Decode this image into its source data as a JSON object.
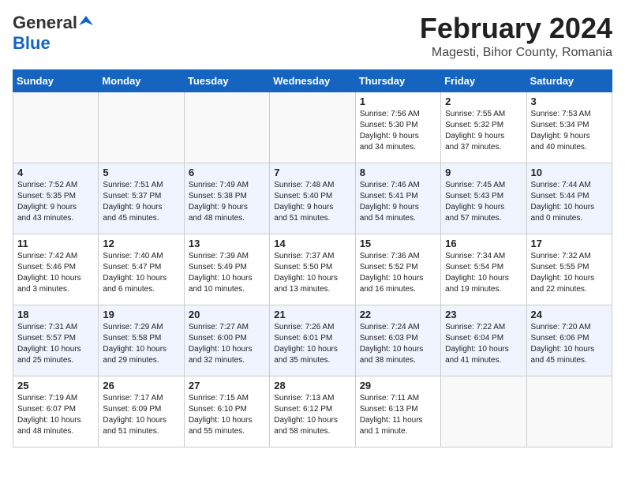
{
  "logo": {
    "general": "General",
    "blue": "Blue"
  },
  "title": "February 2024",
  "location": "Magesti, Bihor County, Romania",
  "days_of_week": [
    "Sunday",
    "Monday",
    "Tuesday",
    "Wednesday",
    "Thursday",
    "Friday",
    "Saturday"
  ],
  "weeks": [
    [
      {
        "day": "",
        "info": ""
      },
      {
        "day": "",
        "info": ""
      },
      {
        "day": "",
        "info": ""
      },
      {
        "day": "",
        "info": ""
      },
      {
        "day": "1",
        "info": "Sunrise: 7:56 AM\nSunset: 5:30 PM\nDaylight: 9 hours\nand 34 minutes."
      },
      {
        "day": "2",
        "info": "Sunrise: 7:55 AM\nSunset: 5:32 PM\nDaylight: 9 hours\nand 37 minutes."
      },
      {
        "day": "3",
        "info": "Sunrise: 7:53 AM\nSunset: 5:34 PM\nDaylight: 9 hours\nand 40 minutes."
      }
    ],
    [
      {
        "day": "4",
        "info": "Sunrise: 7:52 AM\nSunset: 5:35 PM\nDaylight: 9 hours\nand 43 minutes."
      },
      {
        "day": "5",
        "info": "Sunrise: 7:51 AM\nSunset: 5:37 PM\nDaylight: 9 hours\nand 45 minutes."
      },
      {
        "day": "6",
        "info": "Sunrise: 7:49 AM\nSunset: 5:38 PM\nDaylight: 9 hours\nand 48 minutes."
      },
      {
        "day": "7",
        "info": "Sunrise: 7:48 AM\nSunset: 5:40 PM\nDaylight: 9 hours\nand 51 minutes."
      },
      {
        "day": "8",
        "info": "Sunrise: 7:46 AM\nSunset: 5:41 PM\nDaylight: 9 hours\nand 54 minutes."
      },
      {
        "day": "9",
        "info": "Sunrise: 7:45 AM\nSunset: 5:43 PM\nDaylight: 9 hours\nand 57 minutes."
      },
      {
        "day": "10",
        "info": "Sunrise: 7:44 AM\nSunset: 5:44 PM\nDaylight: 10 hours\nand 0 minutes."
      }
    ],
    [
      {
        "day": "11",
        "info": "Sunrise: 7:42 AM\nSunset: 5:46 PM\nDaylight: 10 hours\nand 3 minutes."
      },
      {
        "day": "12",
        "info": "Sunrise: 7:40 AM\nSunset: 5:47 PM\nDaylight: 10 hours\nand 6 minutes."
      },
      {
        "day": "13",
        "info": "Sunrise: 7:39 AM\nSunset: 5:49 PM\nDaylight: 10 hours\nand 10 minutes."
      },
      {
        "day": "14",
        "info": "Sunrise: 7:37 AM\nSunset: 5:50 PM\nDaylight: 10 hours\nand 13 minutes."
      },
      {
        "day": "15",
        "info": "Sunrise: 7:36 AM\nSunset: 5:52 PM\nDaylight: 10 hours\nand 16 minutes."
      },
      {
        "day": "16",
        "info": "Sunrise: 7:34 AM\nSunset: 5:54 PM\nDaylight: 10 hours\nand 19 minutes."
      },
      {
        "day": "17",
        "info": "Sunrise: 7:32 AM\nSunset: 5:55 PM\nDaylight: 10 hours\nand 22 minutes."
      }
    ],
    [
      {
        "day": "18",
        "info": "Sunrise: 7:31 AM\nSunset: 5:57 PM\nDaylight: 10 hours\nand 25 minutes."
      },
      {
        "day": "19",
        "info": "Sunrise: 7:29 AM\nSunset: 5:58 PM\nDaylight: 10 hours\nand 29 minutes."
      },
      {
        "day": "20",
        "info": "Sunrise: 7:27 AM\nSunset: 6:00 PM\nDaylight: 10 hours\nand 32 minutes."
      },
      {
        "day": "21",
        "info": "Sunrise: 7:26 AM\nSunset: 6:01 PM\nDaylight: 10 hours\nand 35 minutes."
      },
      {
        "day": "22",
        "info": "Sunrise: 7:24 AM\nSunset: 6:03 PM\nDaylight: 10 hours\nand 38 minutes."
      },
      {
        "day": "23",
        "info": "Sunrise: 7:22 AM\nSunset: 6:04 PM\nDaylight: 10 hours\nand 41 minutes."
      },
      {
        "day": "24",
        "info": "Sunrise: 7:20 AM\nSunset: 6:06 PM\nDaylight: 10 hours\nand 45 minutes."
      }
    ],
    [
      {
        "day": "25",
        "info": "Sunrise: 7:19 AM\nSunset: 6:07 PM\nDaylight: 10 hours\nand 48 minutes."
      },
      {
        "day": "26",
        "info": "Sunrise: 7:17 AM\nSunset: 6:09 PM\nDaylight: 10 hours\nand 51 minutes."
      },
      {
        "day": "27",
        "info": "Sunrise: 7:15 AM\nSunset: 6:10 PM\nDaylight: 10 hours\nand 55 minutes."
      },
      {
        "day": "28",
        "info": "Sunrise: 7:13 AM\nSunset: 6:12 PM\nDaylight: 10 hours\nand 58 minutes."
      },
      {
        "day": "29",
        "info": "Sunrise: 7:11 AM\nSunset: 6:13 PM\nDaylight: 11 hours\nand 1 minute."
      },
      {
        "day": "",
        "info": ""
      },
      {
        "day": "",
        "info": ""
      }
    ]
  ]
}
